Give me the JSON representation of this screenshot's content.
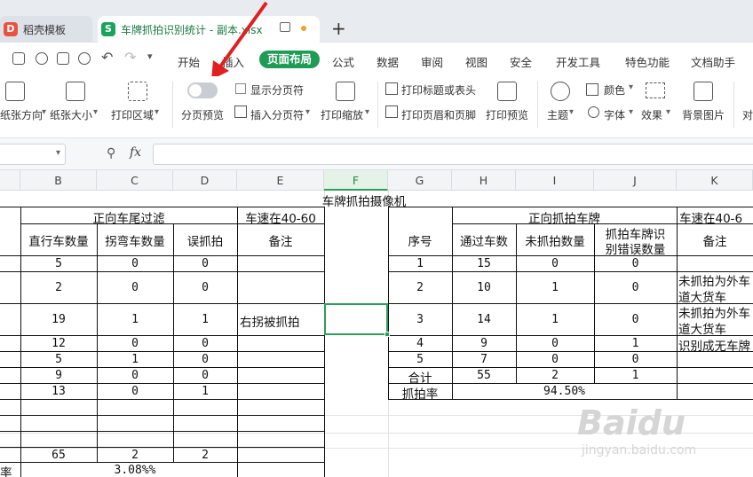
{
  "window": {
    "tab_home": "稻壳模板",
    "tab_file": "车牌抓拍识别统计 - 副本.xlsx",
    "tab_add": "+"
  },
  "menu": [
    "开始",
    "插入",
    "页面布局",
    "公式",
    "数据",
    "审阅",
    "视图",
    "安全",
    "开发工具",
    "特色功能",
    "文档助手"
  ],
  "ribbon": {
    "orientation": "纸张方向",
    "size": "纸张大小",
    "print_area": "打印区域",
    "page_break_preview": "分页预览",
    "show_page_break": "显示分页符",
    "insert_page_break": "插入分页符",
    "print_zoom": "打印缩放",
    "print_titles": "打印标题或表头",
    "print_header_footer": "打印页眉和页脚",
    "print_preview": "打印预览",
    "theme": "主题",
    "colors": "颜色",
    "fonts": "字体",
    "effects": "效果",
    "background": "背景图片",
    "align": "对"
  },
  "formula_bar": {
    "fx": "fx",
    "name_box": "",
    "formula": ""
  },
  "columns": [
    "B",
    "C",
    "D",
    "E",
    "F",
    "G",
    "H",
    "I",
    "J",
    "K"
  ],
  "selected_column": "F",
  "sheet": {
    "main_title": "车牌抓拍摄像机",
    "left_group": "正向车尾过滤",
    "left_speed": "车速在40-60",
    "left_headers": [
      "直行车数量",
      "拐弯车数量",
      "误抓拍",
      "备注"
    ],
    "left_rows": [
      [
        "5",
        "0",
        "0",
        ""
      ],
      [
        "2",
        "0",
        "0",
        ""
      ],
      [
        "19",
        "1",
        "1",
        "右拐被抓拍"
      ],
      [
        "12",
        "0",
        "0",
        ""
      ],
      [
        "5",
        "1",
        "0",
        ""
      ],
      [
        "9",
        "0",
        "0",
        ""
      ],
      [
        "13",
        "0",
        "1",
        ""
      ]
    ],
    "left_totals": [
      "65",
      "2",
      "2"
    ],
    "left_rate_label": "率",
    "left_rate": "3.08%%",
    "right_seq": "序号",
    "right_group": "正向抓拍车牌",
    "right_speed": "车速在40-6",
    "right_headers": [
      "通过车数",
      "未抓拍数量",
      "抓拍车牌识",
      "别错误数量",
      "备注"
    ],
    "right_rows": [
      [
        "1",
        "15",
        "0",
        "0",
        ""
      ],
      [
        "2",
        "10",
        "1",
        "0",
        "未抓拍为外车",
        "道大货车"
      ],
      [
        "3",
        "14",
        "1",
        "0",
        "未抓拍为外车",
        "道大货车"
      ],
      [
        "4",
        "9",
        "0",
        "1",
        "识别成无车牌"
      ],
      [
        "5",
        "7",
        "0",
        "0",
        ""
      ]
    ],
    "right_total": [
      "合计",
      "55",
      "2",
      "1"
    ],
    "right_rate": [
      "抓拍率",
      "94.50%"
    ]
  },
  "watermark": {
    "brand": "Baidu",
    "sub": "jingyan.baidu.com"
  },
  "colors": {
    "accent": "#1e9c56",
    "arrow": "#e02020",
    "tab_icon": "#1aa35a"
  }
}
